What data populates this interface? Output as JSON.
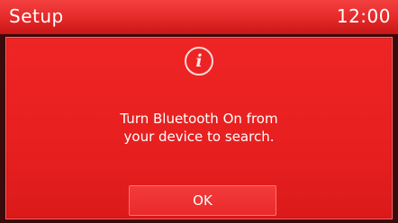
{
  "status_bar": {
    "title": "Setup",
    "clock": "12:00"
  },
  "dialog": {
    "icon": "info-icon",
    "message_lines": [
      "Turn Bluetooth On from",
      "your device to search."
    ],
    "ok_label": "OK"
  },
  "colors": {
    "accent_red": "#e71f1f",
    "text": "#ffffff"
  }
}
